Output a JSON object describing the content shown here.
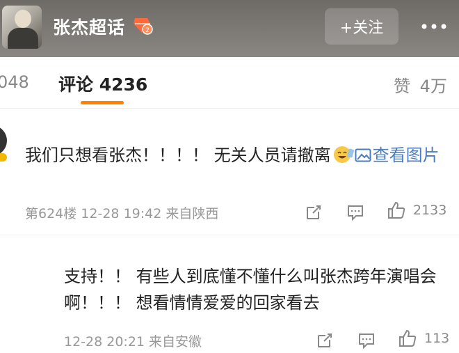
{
  "header": {
    "topic_title": "张杰超话",
    "follow_label": "+关注"
  },
  "tabs": {
    "repost_count": "048",
    "comments_label": "评论 4236",
    "likes_label": "赞",
    "likes_count": "4万"
  },
  "comments": [
    {
      "text": "我们只想看张杰！！！！ 无关人员请撤离",
      "view_image_label": "查看图片",
      "meta": "第624楼  12-28 19:42  来自陕西",
      "like_count": "2133"
    },
    {
      "text": "支持！！ 有些人到底懂不懂什么叫张杰跨年演唱会啊！！！ 想看情情爱爱的回家看去",
      "meta": "12-28 20:21  来自安徽",
      "like_count": "113"
    }
  ],
  "colors": {
    "header_bg": "#7a7671",
    "accent": "#ff8200",
    "link": "#4a7cbf"
  }
}
